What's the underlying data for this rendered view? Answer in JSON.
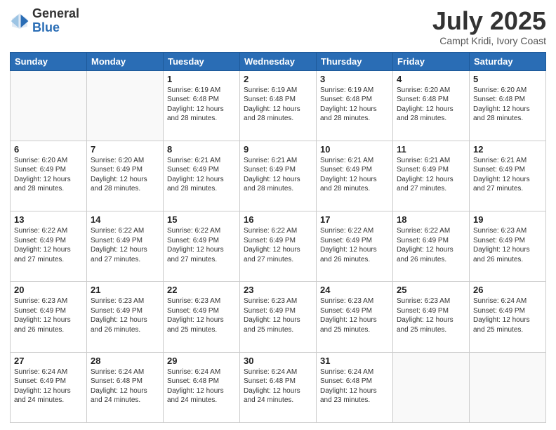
{
  "header": {
    "logo_general": "General",
    "logo_blue": "Blue",
    "month_title": "July 2025",
    "subtitle": "Campt Kridi, Ivory Coast"
  },
  "days_of_week": [
    "Sunday",
    "Monday",
    "Tuesday",
    "Wednesday",
    "Thursday",
    "Friday",
    "Saturday"
  ],
  "weeks": [
    [
      {
        "day": "",
        "info": ""
      },
      {
        "day": "",
        "info": ""
      },
      {
        "day": "1",
        "info": "Sunrise: 6:19 AM\nSunset: 6:48 PM\nDaylight: 12 hours and 28 minutes."
      },
      {
        "day": "2",
        "info": "Sunrise: 6:19 AM\nSunset: 6:48 PM\nDaylight: 12 hours and 28 minutes."
      },
      {
        "day": "3",
        "info": "Sunrise: 6:19 AM\nSunset: 6:48 PM\nDaylight: 12 hours and 28 minutes."
      },
      {
        "day": "4",
        "info": "Sunrise: 6:20 AM\nSunset: 6:48 PM\nDaylight: 12 hours and 28 minutes."
      },
      {
        "day": "5",
        "info": "Sunrise: 6:20 AM\nSunset: 6:48 PM\nDaylight: 12 hours and 28 minutes."
      }
    ],
    [
      {
        "day": "6",
        "info": "Sunrise: 6:20 AM\nSunset: 6:49 PM\nDaylight: 12 hours and 28 minutes."
      },
      {
        "day": "7",
        "info": "Sunrise: 6:20 AM\nSunset: 6:49 PM\nDaylight: 12 hours and 28 minutes."
      },
      {
        "day": "8",
        "info": "Sunrise: 6:21 AM\nSunset: 6:49 PM\nDaylight: 12 hours and 28 minutes."
      },
      {
        "day": "9",
        "info": "Sunrise: 6:21 AM\nSunset: 6:49 PM\nDaylight: 12 hours and 28 minutes."
      },
      {
        "day": "10",
        "info": "Sunrise: 6:21 AM\nSunset: 6:49 PM\nDaylight: 12 hours and 28 minutes."
      },
      {
        "day": "11",
        "info": "Sunrise: 6:21 AM\nSunset: 6:49 PM\nDaylight: 12 hours and 27 minutes."
      },
      {
        "day": "12",
        "info": "Sunrise: 6:21 AM\nSunset: 6:49 PM\nDaylight: 12 hours and 27 minutes."
      }
    ],
    [
      {
        "day": "13",
        "info": "Sunrise: 6:22 AM\nSunset: 6:49 PM\nDaylight: 12 hours and 27 minutes."
      },
      {
        "day": "14",
        "info": "Sunrise: 6:22 AM\nSunset: 6:49 PM\nDaylight: 12 hours and 27 minutes."
      },
      {
        "day": "15",
        "info": "Sunrise: 6:22 AM\nSunset: 6:49 PM\nDaylight: 12 hours and 27 minutes."
      },
      {
        "day": "16",
        "info": "Sunrise: 6:22 AM\nSunset: 6:49 PM\nDaylight: 12 hours and 27 minutes."
      },
      {
        "day": "17",
        "info": "Sunrise: 6:22 AM\nSunset: 6:49 PM\nDaylight: 12 hours and 26 minutes."
      },
      {
        "day": "18",
        "info": "Sunrise: 6:22 AM\nSunset: 6:49 PM\nDaylight: 12 hours and 26 minutes."
      },
      {
        "day": "19",
        "info": "Sunrise: 6:23 AM\nSunset: 6:49 PM\nDaylight: 12 hours and 26 minutes."
      }
    ],
    [
      {
        "day": "20",
        "info": "Sunrise: 6:23 AM\nSunset: 6:49 PM\nDaylight: 12 hours and 26 minutes."
      },
      {
        "day": "21",
        "info": "Sunrise: 6:23 AM\nSunset: 6:49 PM\nDaylight: 12 hours and 26 minutes."
      },
      {
        "day": "22",
        "info": "Sunrise: 6:23 AM\nSunset: 6:49 PM\nDaylight: 12 hours and 25 minutes."
      },
      {
        "day": "23",
        "info": "Sunrise: 6:23 AM\nSunset: 6:49 PM\nDaylight: 12 hours and 25 minutes."
      },
      {
        "day": "24",
        "info": "Sunrise: 6:23 AM\nSunset: 6:49 PM\nDaylight: 12 hours and 25 minutes."
      },
      {
        "day": "25",
        "info": "Sunrise: 6:23 AM\nSunset: 6:49 PM\nDaylight: 12 hours and 25 minutes."
      },
      {
        "day": "26",
        "info": "Sunrise: 6:24 AM\nSunset: 6:49 PM\nDaylight: 12 hours and 25 minutes."
      }
    ],
    [
      {
        "day": "27",
        "info": "Sunrise: 6:24 AM\nSunset: 6:49 PM\nDaylight: 12 hours and 24 minutes."
      },
      {
        "day": "28",
        "info": "Sunrise: 6:24 AM\nSunset: 6:48 PM\nDaylight: 12 hours and 24 minutes."
      },
      {
        "day": "29",
        "info": "Sunrise: 6:24 AM\nSunset: 6:48 PM\nDaylight: 12 hours and 24 minutes."
      },
      {
        "day": "30",
        "info": "Sunrise: 6:24 AM\nSunset: 6:48 PM\nDaylight: 12 hours and 24 minutes."
      },
      {
        "day": "31",
        "info": "Sunrise: 6:24 AM\nSunset: 6:48 PM\nDaylight: 12 hours and 23 minutes."
      },
      {
        "day": "",
        "info": ""
      },
      {
        "day": "",
        "info": ""
      }
    ]
  ]
}
